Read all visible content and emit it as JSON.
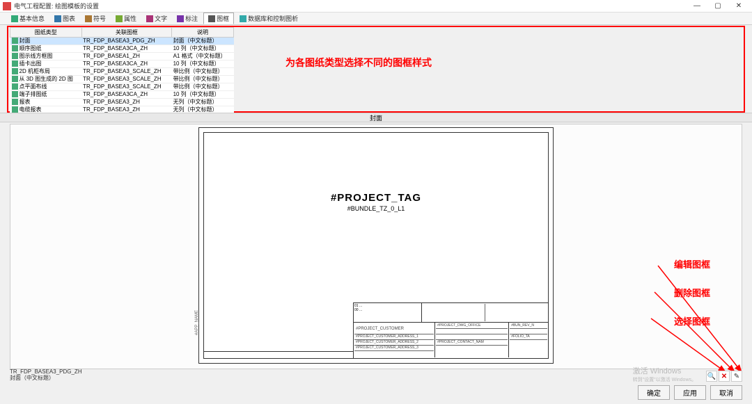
{
  "titlebar": {
    "title": "电气工程配置: 绘图模板的设置"
  },
  "toolbar": {
    "tabs": [
      {
        "label": "基本信息"
      },
      {
        "label": "图表"
      },
      {
        "label": "符号"
      },
      {
        "label": "属性"
      },
      {
        "label": "文字"
      },
      {
        "label": "标注"
      },
      {
        "label": "图框"
      },
      {
        "label": "数据库和控制图析"
      }
    ],
    "active_index": 6
  },
  "table": {
    "headers": [
      "图纸类型",
      "关联图框",
      "说明"
    ],
    "rows": [
      {
        "c0": "封面",
        "c1": "TR_FDP_BASEA3_PDG_ZH",
        "c2": "封面（中文标题）",
        "sel": true
      },
      {
        "c0": "顺序图纸",
        "c1": "TR_FDP_BASEA3CA_ZH",
        "c2": "10 列（中文标题）"
      },
      {
        "c0": "图示线方框图",
        "c1": "TR_FDP_BASEA1_ZH",
        "c2": "A1 格式（中文标题）"
      },
      {
        "c0": "插卡出图",
        "c1": "TR_FDP_BASEA3CA_ZH",
        "c2": "10 列（中文标题）"
      },
      {
        "c0": "2D 机柜布局",
        "c1": "TR_FDP_BASEA3_SCALE_ZH",
        "c2": "带比例（中文标题）"
      },
      {
        "c0": "从 3D 图生成的 2D 图",
        "c1": "TR_FDP_BASEA3_SCALE_ZH",
        "c2": "带比例（中文标题）"
      },
      {
        "c0": "点平面布线",
        "c1": "TR_FDP_BASEA3_SCALE_ZH",
        "c2": "带比例（中文标题）"
      },
      {
        "c0": "端子排图纸",
        "c1": "TR_FDP_BASEA3CA_ZH",
        "c2": "10 列（中文标题）"
      },
      {
        "c0": "报表",
        "c1": "TR_FDP_BASEA3_ZH",
        "c2": "无列（中文标题）"
      },
      {
        "c0": "电缆报表",
        "c1": "TR_FDP_BASEA3_ZH",
        "c2": "无列（中文标题）"
      }
    ]
  },
  "annotation_main": "为各图纸类型选择不同的图框样式",
  "section_label": "封面",
  "drawing": {
    "project_tag": "#PROJECT_TAG",
    "bundle": "#BUNDLE_TZ_0_L1",
    "app_name": "#APP_NAME",
    "titleblock": {
      "customer": "#PROJECT_CUSTOMER",
      "addr1": "#PROJECT_CUSTOMER_ADDRESS_1",
      "addr2": "#PROJECT_CUSTOMER_ADDRESS_2",
      "addr3": "#PROJECT_CUSTOMER_ADDRESS_3",
      "dwg_office": "#PROJECT_DWG_OFFICE",
      "contact": "#PROJECT_CONTACT_NAM",
      "bun_rev": "#BUN_REV_N",
      "folio": "#FOLIO_TA"
    }
  },
  "right_annotations": {
    "edit": "编辑图框",
    "delete": "删除图框",
    "select": "选择图框"
  },
  "statusbar": {
    "line1": "TR_FDP_BASEA3_PDG_ZH",
    "line2": "封面（中文标题）"
  },
  "footer": {
    "ok": "确定",
    "apply": "应用",
    "cancel": "取消"
  },
  "icon_buttons": {
    "browse": "🔍",
    "delete": "✕",
    "edit": "✎"
  },
  "watermark": {
    "l1": "激活 Windows",
    "l2": "转到\"设置\"以激活 Windows。"
  }
}
